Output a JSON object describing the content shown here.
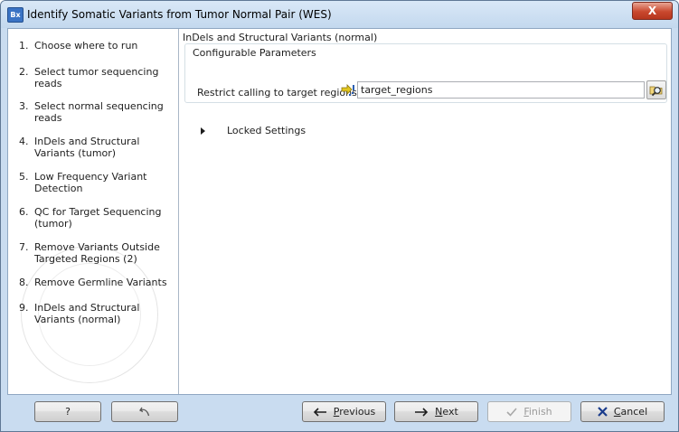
{
  "window": {
    "app_icon_text": "Bx",
    "title": "Identify Somatic Variants from Tumor Normal Pair (WES)",
    "close_glyph": "X"
  },
  "steps": [
    {
      "num": "1.",
      "label": "Choose where to run"
    },
    {
      "num": "2.",
      "label": "Select tumor sequencing reads"
    },
    {
      "num": "3.",
      "label": "Select normal sequencing reads"
    },
    {
      "num": "4.",
      "label": "InDels and Structural Variants (tumor)"
    },
    {
      "num": "5.",
      "label": "Low Frequency Variant Detection"
    },
    {
      "num": "6.",
      "label": "QC for Target Sequencing (tumor)"
    },
    {
      "num": "7.",
      "label": "Remove Variants Outside Targeted Regions (2)"
    },
    {
      "num": "8.",
      "label": "Remove Germline Variants"
    },
    {
      "num": "9.",
      "label": "InDels and Structural Variants (normal)"
    }
  ],
  "content": {
    "section_title": "InDels and Structural Variants (normal)",
    "group_title": "Configurable Parameters",
    "param_label": "Restrict calling to target regions",
    "param_value": "target_regions",
    "locked_label": "Locked Settings"
  },
  "footer": {
    "help_label": "?",
    "previous_label": "Previous",
    "next_label": "Next",
    "finish_label": "Finish",
    "cancel_label": "Cancel",
    "finish_enabled": false
  },
  "icons": {
    "target_icon": "workflow-input-arrow-icon",
    "browse_icon": "folder-search-icon",
    "reset_icon": "reset-arrow-icon"
  },
  "colors": {
    "frame": "#c9dcf0",
    "cancel_x": "#1a3c8c",
    "input_arrow": "#e2c61f"
  }
}
